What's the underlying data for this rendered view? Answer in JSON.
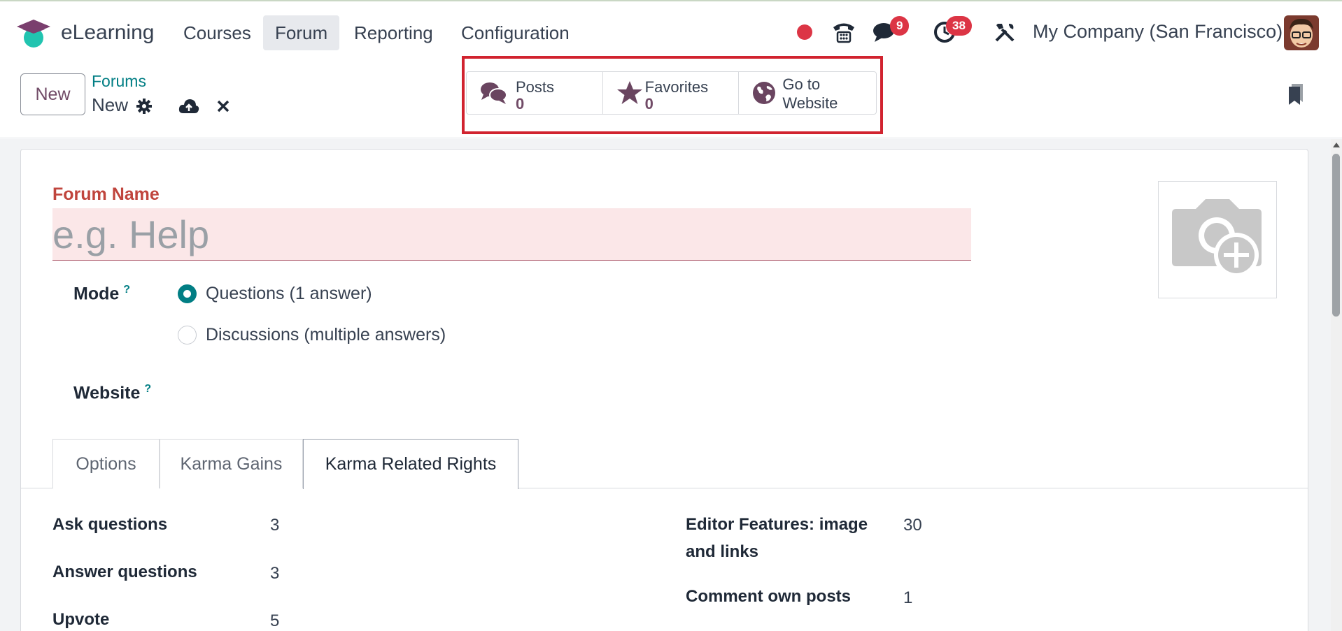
{
  "navbar": {
    "app_name": "eLearning",
    "menu": [
      "Courses",
      "Forum",
      "Reporting",
      "Configuration"
    ],
    "active_menu": "Forum",
    "messages_badge": "9",
    "activities_badge": "38",
    "company": "My Company (San Francisco)",
    "icons": [
      "status-dot-icon",
      "phone-icon",
      "chat-icon",
      "clock-icon",
      "tools-icon"
    ]
  },
  "control": {
    "new_label": "New",
    "breadcrumb": "Forums",
    "record_name": "New",
    "icons": [
      "gear-icon",
      "cloud-upload-icon",
      "close-icon",
      "bookmark-icon"
    ]
  },
  "smart_buttons": [
    {
      "label": "Posts",
      "count": "0",
      "icon": "comments-icon"
    },
    {
      "label": "Favorites",
      "count": "0",
      "icon": "star-icon"
    },
    {
      "label_line1": "Go to",
      "label_line2": "Website",
      "icon": "globe-icon"
    }
  ],
  "form": {
    "forum_name_label": "Forum Name",
    "forum_name_placeholder": "e.g. Help",
    "mode_label": "Mode",
    "help_mark": "?",
    "mode_options": [
      "Questions (1 answer)",
      "Discussions (multiple answers)"
    ],
    "mode_selected": "Questions (1 answer)",
    "website_label": "Website"
  },
  "tabs": [
    "Options",
    "Karma Gains",
    "Karma Related Rights"
  ],
  "active_tab": "Karma Related Rights",
  "karma_rights": {
    "left": [
      {
        "label": "Ask questions",
        "value": "3"
      },
      {
        "label": "Answer questions",
        "value": "3"
      },
      {
        "label": "Upvote",
        "value": "5"
      }
    ],
    "right": [
      {
        "label_line1": "Editor Features: image",
        "label_line2": "and links",
        "value": "30"
      },
      {
        "label": "Comment own posts",
        "value": "1"
      }
    ]
  },
  "colors": {
    "brand_purple": "#714b67",
    "teal": "#017e84",
    "badge_red": "#dc3545",
    "highlight_red": "#d1232f",
    "required_bg": "#fbe7e8"
  }
}
